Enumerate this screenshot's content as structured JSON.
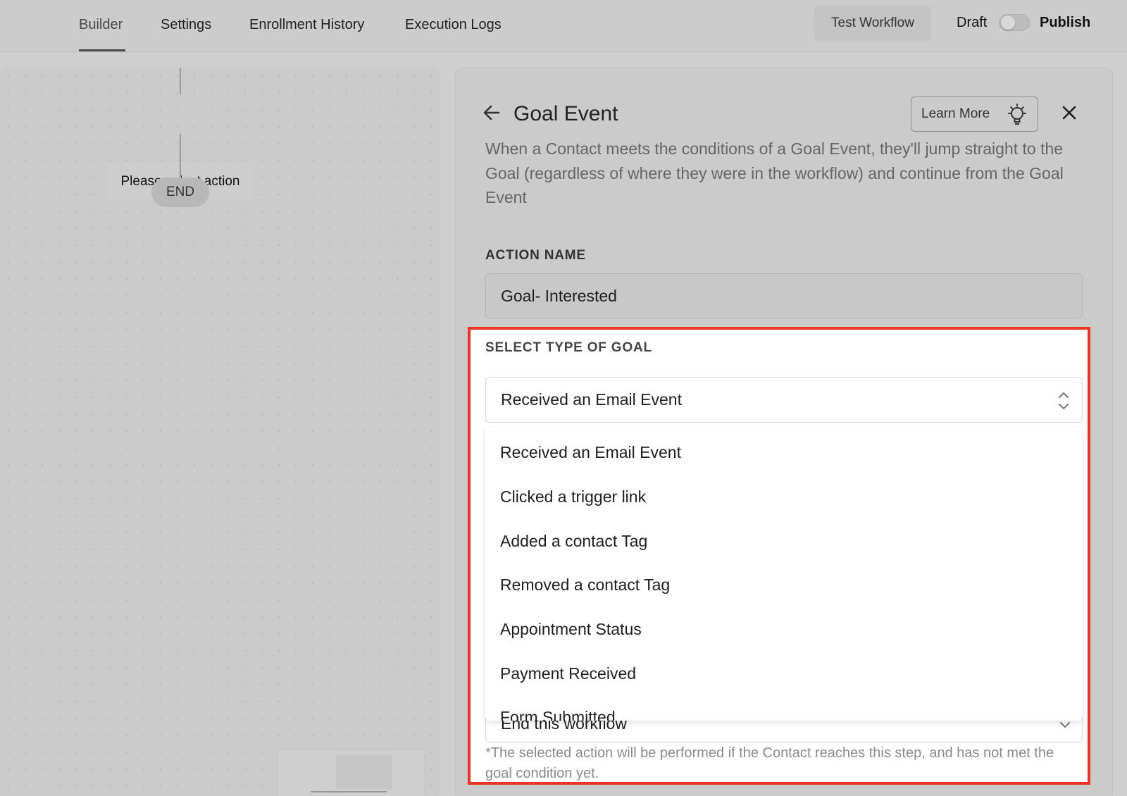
{
  "nav": {
    "tabs": [
      {
        "label": "Builder"
      },
      {
        "label": "Settings"
      },
      {
        "label": "Enrollment History"
      },
      {
        "label": "Execution Logs"
      }
    ],
    "test_workflow": "Test Workflow",
    "draft_label": "Draft",
    "publish_label": "Publish"
  },
  "canvas": {
    "action_node": "Please select action",
    "end_node": "END"
  },
  "panel": {
    "title": "Goal Event",
    "learn_more": "Learn More",
    "description": "When a Contact meets the conditions of a Goal Event, they'll jump straight to the Goal (regardless of where they were in the workflow) and continue from the Goal Event",
    "action_name_label": "ACTION NAME",
    "action_name_value": "Goal- Interested",
    "goal_type_label": "SELECT TYPE OF GOAL",
    "goal_type_selected": "Received an Email Event",
    "goal_type_options": [
      "Received an Email Event",
      "Clicked a trigger link",
      "Added a contact Tag",
      "Removed a contact Tag",
      "Appointment Status",
      "Payment Received",
      "Form Submitted"
    ],
    "end_action_value": "End this workflow",
    "end_action_note": "*The selected action will be performed if the Contact reaches this step, and has not met the goal condition yet."
  },
  "colors": {
    "highlight_border": "#ea3323",
    "page_background": "#cfcfcf"
  }
}
